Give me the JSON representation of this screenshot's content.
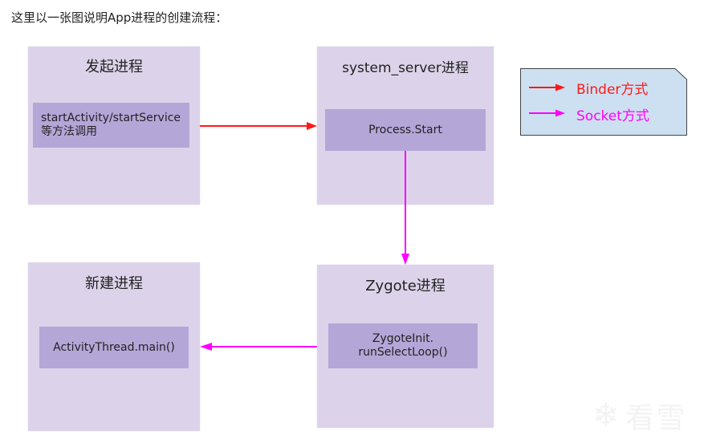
{
  "intro_text": "这里以一张图说明App进程的创建流程：",
  "processes": {
    "initiator": {
      "title": "发起进程",
      "call_line1": "startActivity/startService",
      "call_line2": "等方法调用"
    },
    "system_server": {
      "title": "system_server进程",
      "call": "Process.Start"
    },
    "new_process": {
      "title": "新建进程",
      "call": "ActivityThread.main()"
    },
    "zygote": {
      "title": "Zygote进程",
      "call_line1": "ZygoteInit.",
      "call_line2": "runSelectLoop()"
    }
  },
  "edges": [
    {
      "from": "initiator",
      "to": "system_server",
      "type": "binder"
    },
    {
      "from": "system_server",
      "to": "zygote",
      "type": "socket"
    },
    {
      "from": "zygote",
      "to": "new_process",
      "type": "socket"
    }
  ],
  "legend": {
    "items": [
      {
        "label": "Binder方式",
        "type": "binder",
        "color": "#ff1a1a"
      },
      {
        "label": "Socket方式",
        "type": "socket",
        "color": "#ff00ff"
      }
    ]
  },
  "colors": {
    "binder": "#ff1a1a",
    "socket": "#ff00ff",
    "process_bg": "#dcd3ea",
    "call_bg": "#b5a6d8",
    "legend_bg": "#cde0f1"
  },
  "watermark": {
    "icon": "snowflake-icon",
    "text": "看雪"
  }
}
